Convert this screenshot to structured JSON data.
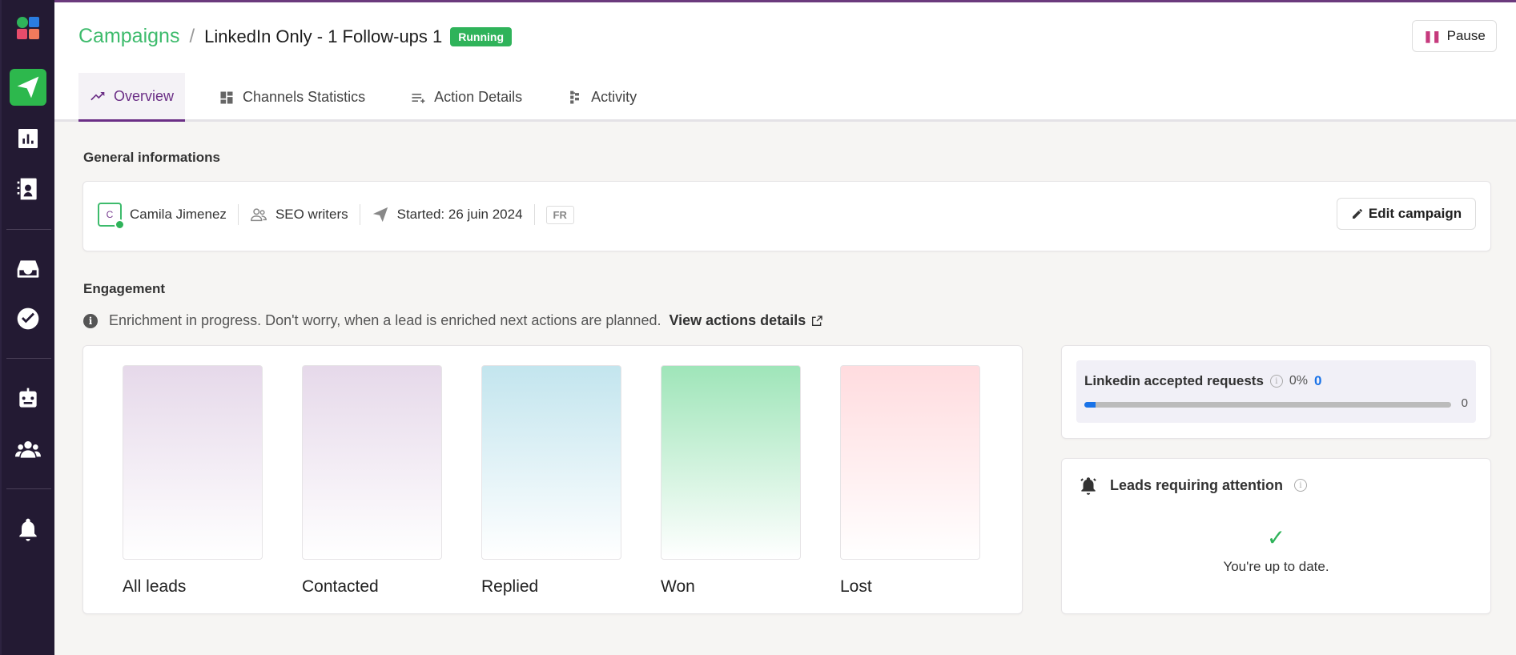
{
  "breadcrumb": {
    "parent": "Campaigns",
    "separator": "/",
    "title": "LinkedIn Only - 1 Follow-ups 1",
    "status": "Running"
  },
  "header": {
    "pause_label": "Pause"
  },
  "tabs": [
    {
      "label": "Overview",
      "icon": "trending-up-icon"
    },
    {
      "label": "Channels Statistics",
      "icon": "dashboard-icon"
    },
    {
      "label": "Action Details",
      "icon": "list-icon"
    },
    {
      "label": "Activity",
      "icon": "tree-icon"
    }
  ],
  "general": {
    "title": "General informations",
    "avatar_letter": "C",
    "owner": "Camila Jimenez",
    "team": "SEO writers",
    "started": "Started: 26 juin 2024",
    "language": "FR",
    "edit_label": "Edit campaign"
  },
  "engagement": {
    "title": "Engagement",
    "notice_icon": "i",
    "notice": "Enrichment in progress. Don't worry, when a lead is enriched next actions are planned.",
    "notice_link": "View actions details",
    "stats": [
      {
        "label": "All leads",
        "color_top": "#e6d9ea"
      },
      {
        "label": "Contacted",
        "color_top": "#e6d9ea"
      },
      {
        "label": "Replied",
        "color_top": "#c3e5ee"
      },
      {
        "label": "Won",
        "color_top": "#9fe5b9"
      },
      {
        "label": "Lost",
        "color_top": "#ffdcdf"
      }
    ]
  },
  "linkedin": {
    "title": "Linkedin accepted requests",
    "info_icon": "i",
    "percent": "0%",
    "value": "0",
    "progress": 0.03,
    "bar_max": "0"
  },
  "attention": {
    "title": "Leads requiring attention",
    "info_icon": "i",
    "check": "✓",
    "message": "You're up to date."
  },
  "colors": {
    "accent": "#6b2f86",
    "green": "#2fb35a",
    "sidebar": "#231a33",
    "link_blue": "#1a73e8"
  }
}
